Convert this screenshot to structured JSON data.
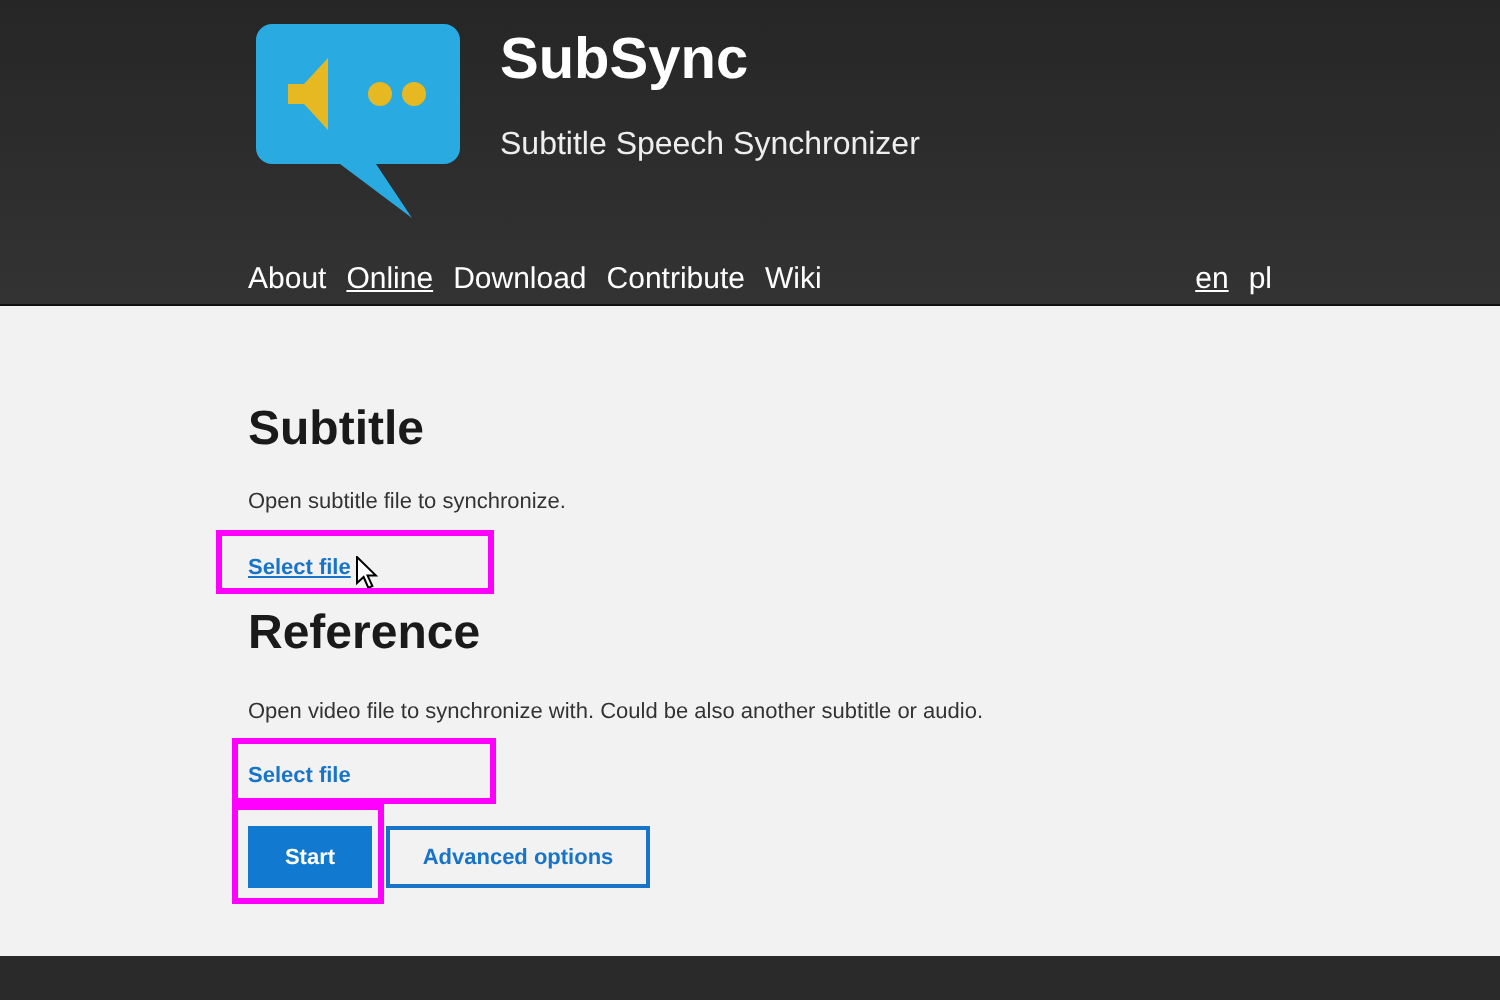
{
  "header": {
    "title": "SubSync",
    "tagline": "Subtitle Speech Synchronizer"
  },
  "nav": [
    {
      "label": "About",
      "selected": false
    },
    {
      "label": "Online",
      "selected": true
    },
    {
      "label": "Download",
      "selected": false
    },
    {
      "label": "Contribute",
      "selected": false
    },
    {
      "label": "Wiki",
      "selected": false
    }
  ],
  "languages": [
    {
      "label": "en",
      "selected": true
    },
    {
      "label": "pl",
      "selected": false
    }
  ],
  "sections": [
    {
      "heading": "Subtitle",
      "description": "Open subtitle file to synchronize.",
      "link": {
        "label": "Select file",
        "hovered": true,
        "highlighted": true
      }
    },
    {
      "heading": "Reference",
      "description": "Open video file to synchronize with. Could be also another subtitle or audio.",
      "link": {
        "label": "Select file",
        "hovered": false,
        "highlighted": true
      }
    }
  ],
  "buttons": [
    {
      "label": "Start",
      "kind": "primary",
      "highlighted": true
    },
    {
      "label": "Advanced options",
      "kind": "outline",
      "highlighted": false
    }
  ]
}
